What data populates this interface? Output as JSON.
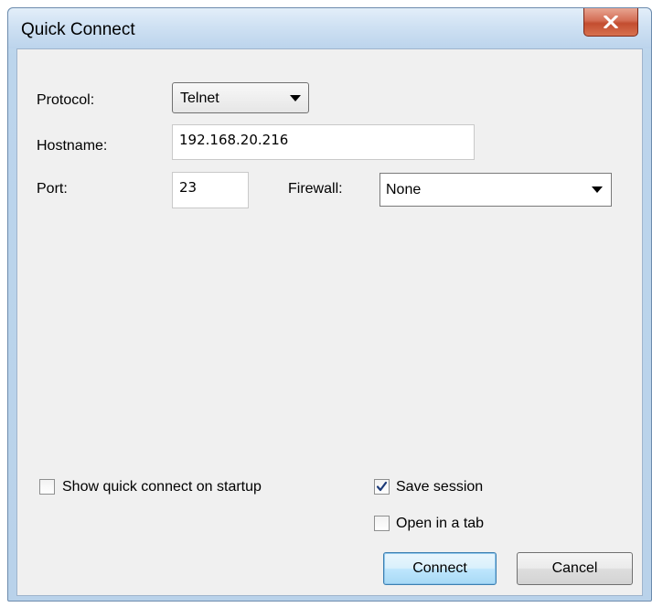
{
  "window": {
    "title": "Quick Connect"
  },
  "form": {
    "protocol_label": "Protocol:",
    "protocol_value": "Telnet",
    "hostname_label": "Hostname:",
    "hostname_value": "192.168.20.216",
    "port_label": "Port:",
    "port_value": "23",
    "firewall_label": "Firewall:",
    "firewall_value": "None"
  },
  "options": {
    "show_on_startup_label": "Show quick connect on startup",
    "show_on_startup_checked": false,
    "save_session_label": "Save session",
    "save_session_checked": true,
    "open_in_tab_label": "Open in a tab",
    "open_in_tab_checked": false
  },
  "buttons": {
    "connect_label": "Connect",
    "cancel_label": "Cancel"
  },
  "icons": {
    "close": "close-icon",
    "dropdown": "chevron-down-icon",
    "checkmark": "checkmark-icon"
  },
  "colors": {
    "close_button": "#c34d30",
    "default_button_border": "#3c7fb1",
    "dialog_background": "#f0f0f0"
  }
}
